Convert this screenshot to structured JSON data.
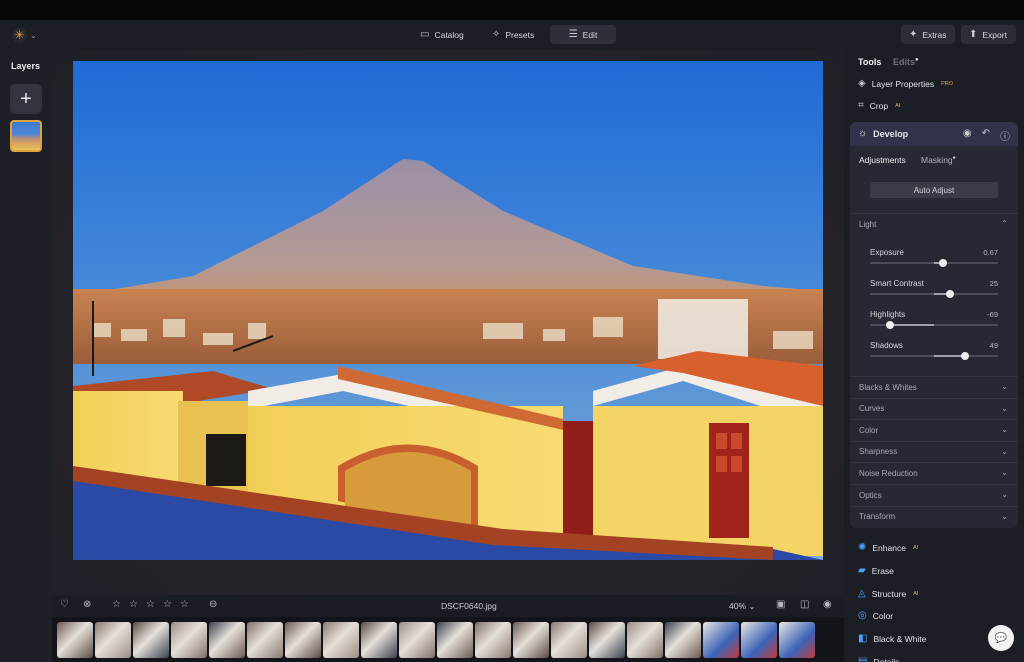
{
  "topbar": {
    "nav": [
      {
        "label": "Catalog",
        "icon": "folder-icon"
      },
      {
        "label": "Presets",
        "icon": "sparkle-icon"
      },
      {
        "label": "Edit",
        "icon": "sliders-icon",
        "active": true
      }
    ],
    "extras_label": "Extras",
    "export_label": "Export"
  },
  "left_panel": {
    "title": "Layers"
  },
  "photo": {
    "filename": "DSCF0640.jpg",
    "zoom": "40%",
    "rating_stars": 0
  },
  "filmstrip": {
    "frames": 20
  },
  "right_panel": {
    "tabs": {
      "tools": "Tools",
      "edits": "Edits"
    },
    "tools": [
      {
        "label": "Layer Properties",
        "badge": "PRO",
        "icon": "layers-icon"
      },
      {
        "label": "Crop",
        "badge": "AI",
        "icon": "crop-icon"
      }
    ],
    "develop": {
      "title": "Develop",
      "subtabs": {
        "adjustments": "Adjustments",
        "masking": "Masking"
      },
      "auto_adjust": "Auto Adjust",
      "light_title": "Light",
      "sliders": [
        {
          "label": "Exposure",
          "value": "0.67",
          "min": -5,
          "max": 5,
          "num": 0.67
        },
        {
          "label": "Smart Contrast",
          "value": "25",
          "min": -100,
          "max": 100,
          "num": 25
        },
        {
          "label": "Highlights",
          "value": "-69",
          "min": -100,
          "max": 100,
          "num": -69
        },
        {
          "label": "Shadows",
          "value": "49",
          "min": -100,
          "max": 100,
          "num": 49
        }
      ],
      "sections": [
        "Blacks & Whites",
        "Curves",
        "Color",
        "Sharpness",
        "Noise Reduction",
        "Optics",
        "Transform"
      ]
    },
    "more_tools": [
      {
        "label": "Enhance",
        "badge": "AI",
        "icon": "enhance-icon",
        "color": "#4aa3ff"
      },
      {
        "label": "Erase",
        "badge": "",
        "icon": "erase-icon",
        "color": "#4aa3ff"
      },
      {
        "label": "Structure",
        "badge": "AI",
        "icon": "structure-icon",
        "color": "#4aa3ff"
      },
      {
        "label": "Color",
        "badge": "",
        "icon": "color-icon",
        "color": "#4aa3ff"
      },
      {
        "label": "Black & White",
        "badge": "",
        "icon": "bw-icon",
        "color": "#4aa3ff"
      },
      {
        "label": "Details",
        "badge": "",
        "icon": "details-icon",
        "color": "#4aa3ff"
      }
    ]
  },
  "colors": {
    "accent": "#e0a23a",
    "panel_header": "#30334a",
    "tool_icon_blue": "#4aa3ff"
  }
}
